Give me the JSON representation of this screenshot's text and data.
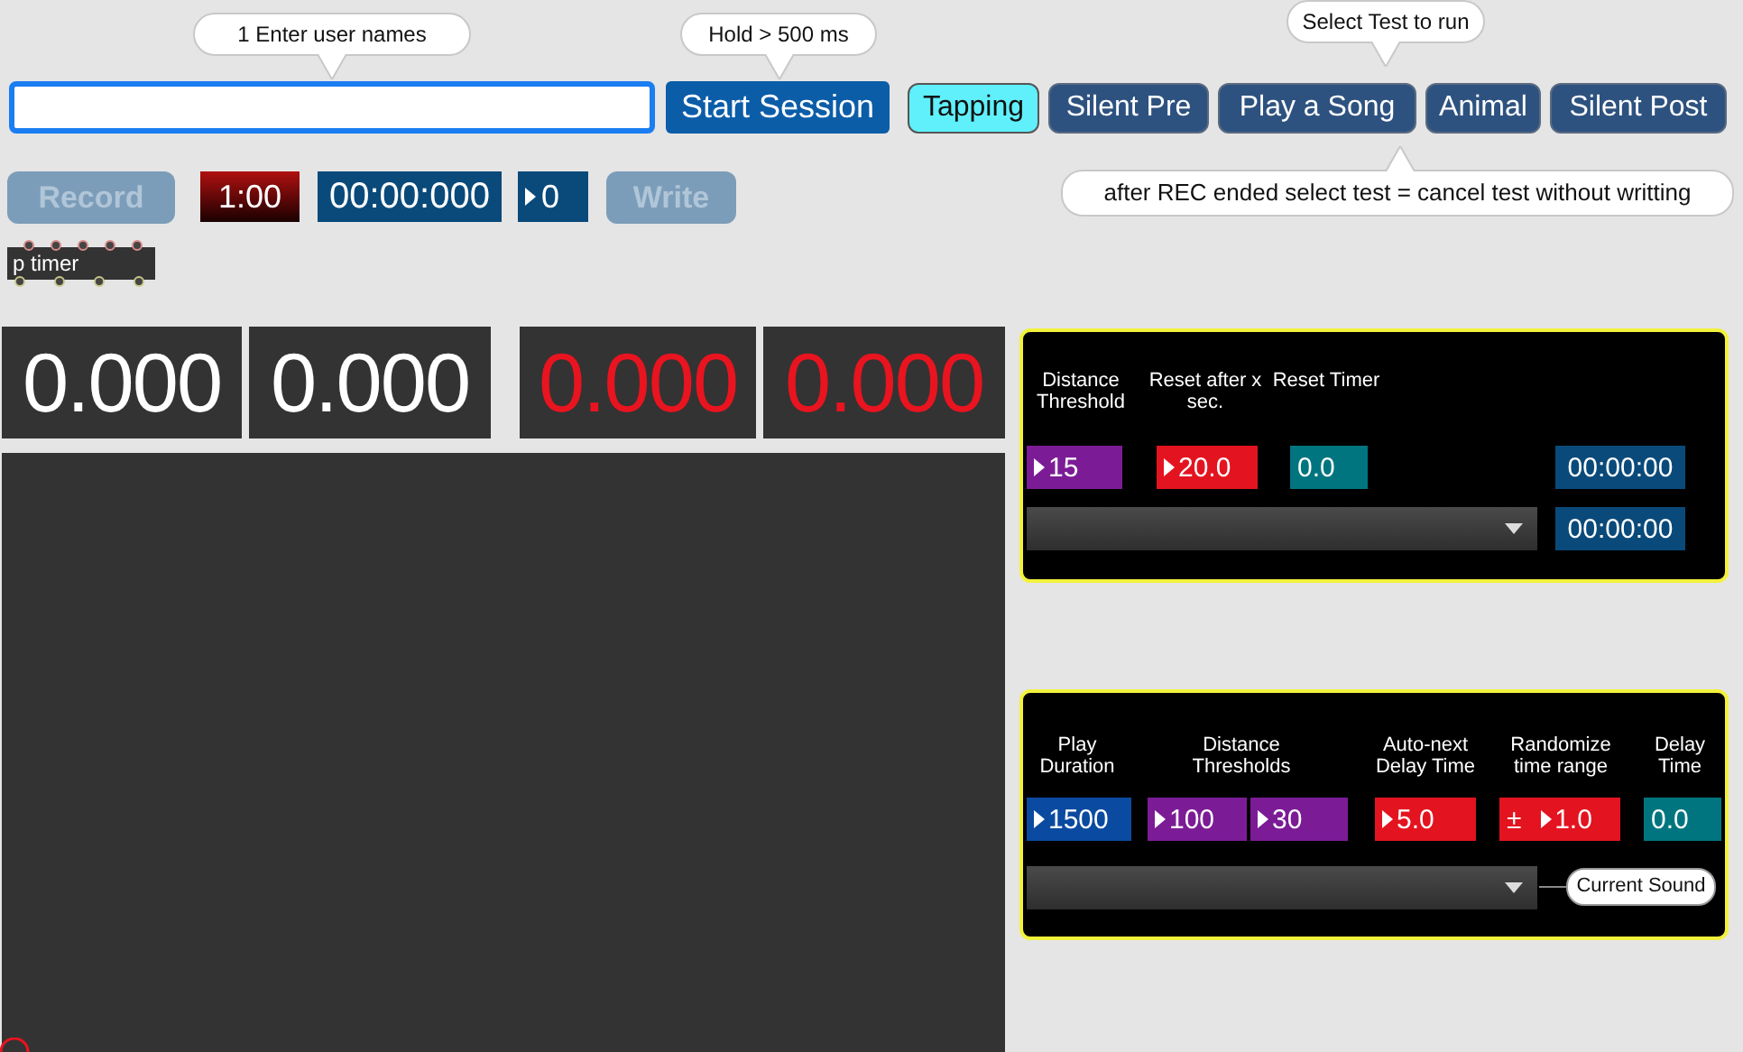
{
  "name_field": {
    "bubble": "1 Enter user names"
  },
  "start_button": {
    "label": "Start Session",
    "disabled": false,
    "bubble": "Hold > 500 ms"
  },
  "tests": {
    "bubble": "Select Test to run",
    "note": "after REC ended select test = cancel test without writting",
    "tabs": [
      {
        "label": "Tapping",
        "selected": true
      },
      {
        "label": "Silent Pre",
        "selected": false
      },
      {
        "label": "Play a Song",
        "selected": false
      },
      {
        "label": "Animal",
        "selected": false
      },
      {
        "label": "Silent Post",
        "selected": false
      }
    ]
  },
  "transport": [
    {
      "kind": "button",
      "label": "Record",
      "disabled": true
    },
    {
      "kind": "countdown",
      "text": "1:00"
    },
    {
      "kind": "clock",
      "text": "00:00:000"
    },
    {
      "kind": "number",
      "text": "0"
    },
    {
      "kind": "button",
      "label": "Write",
      "disabled": true
    }
  ],
  "subpatch": {
    "label": "p timer"
  },
  "readouts": [
    {
      "text": "0.000",
      "color": "#ffffff"
    },
    {
      "text": "0.000",
      "color": "#ffffff"
    },
    {
      "text": "0.000",
      "color": "#e8141f"
    },
    {
      "text": "0.000",
      "color": "#e8141f"
    }
  ],
  "tapping_panel": {
    "headers": [
      "Distance Threshold",
      "Reset after x sec.",
      "Reset Timer"
    ],
    "boxes": [
      {
        "text": "15",
        "arrow": true,
        "color": "#7b1c96"
      },
      {
        "text": "20.0",
        "arrow": true,
        "color": "#e3141f"
      },
      {
        "text": "0.0",
        "arrow": false,
        "color": "#00757f"
      }
    ],
    "clocks": [
      "00:00:00",
      "00:00:00"
    ]
  },
  "song_panel": {
    "headers": [
      "Play Duration",
      "Distance Thresholds",
      "Auto-next Delay Time",
      "Randomize time range",
      "Delay Time"
    ],
    "boxes": [
      {
        "text": "1500",
        "arrow": true,
        "color": "#0a4aa0"
      },
      {
        "text": "100",
        "arrow": true,
        "color": "#7b1c96"
      },
      {
        "text": "30",
        "arrow": true,
        "color": "#7b1c96"
      },
      {
        "text": "5.0",
        "arrow": true,
        "color": "#e3141f"
      },
      {
        "text": "1.0",
        "arrow": true,
        "prefix": "±",
        "color": "#e3141f"
      },
      {
        "text": "0.0",
        "arrow": false,
        "color": "#00757f"
      }
    ],
    "sound_label": "Current Sound"
  }
}
